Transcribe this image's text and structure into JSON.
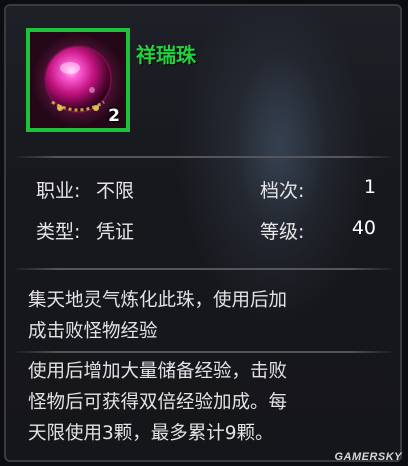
{
  "item": {
    "name": "祥瑞珠",
    "stack_count": "2",
    "icon": "pink-orb-icon",
    "rarity_color": "#1ec23a"
  },
  "stats": {
    "profession_label": "职业:",
    "profession_value": "不限",
    "grade_label": "档次:",
    "grade_value": "1",
    "type_label": "类型:",
    "type_value": "凭证",
    "level_label": "等级:",
    "level_value": "40"
  },
  "description": {
    "lore_line1": "集天地灵气炼化此珠，使用后加",
    "lore_line2": "成击败怪物经验",
    "effect_line1": "使用后增加大量储备经验，击败",
    "effect_line2": "怪物后可获得双倍经验加成。每",
    "effect_line3": "天限使用3颗，最多累计9颗。"
  },
  "watermark": "GAMERSKY"
}
